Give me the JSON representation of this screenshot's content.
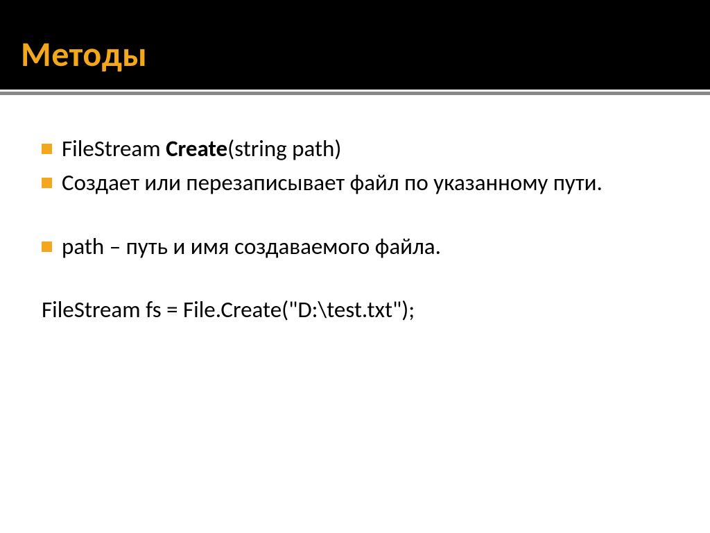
{
  "header": {
    "title": "Методы"
  },
  "content": {
    "item1_prefix": "FileStream ",
    "item1_bold": "Create",
    "item1_suffix": "(string path)",
    "item2": "Создает или перезаписывает файл по указанному пути.",
    "item3": "path – путь и имя создаваемого файла.",
    "code": "FileStream fs = File.Create(\"D:\\test.txt\");"
  }
}
